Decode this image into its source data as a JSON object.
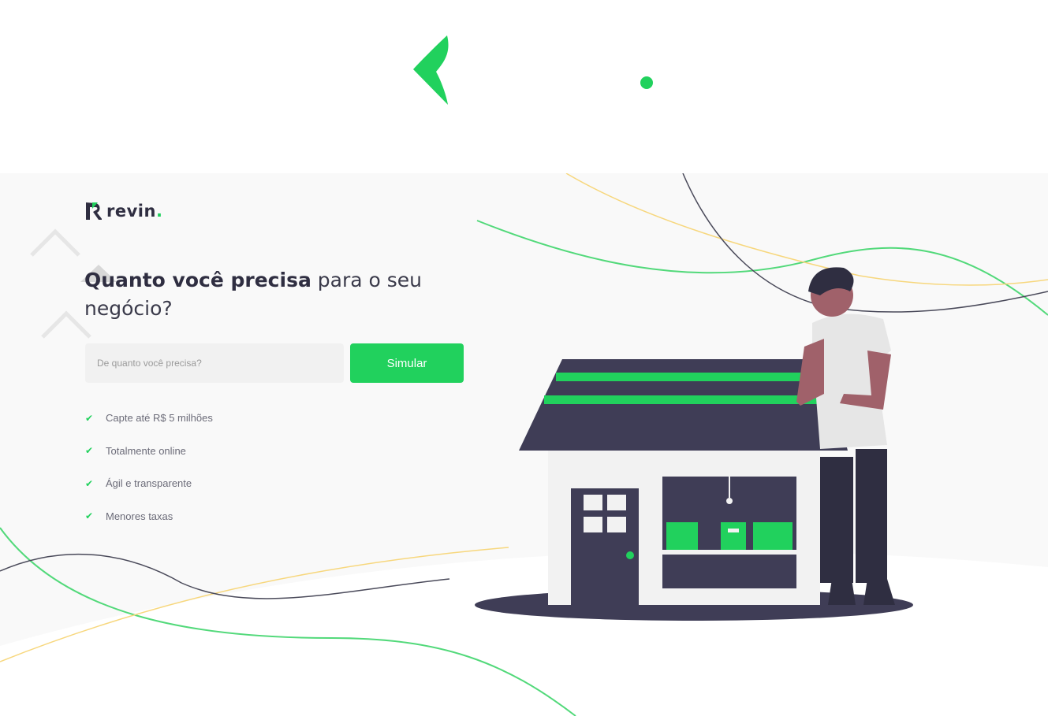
{
  "brand": {
    "name": "revin",
    "dot": ".",
    "green": "#21d15d",
    "dark": "#2f2e41"
  },
  "hero": {
    "headline_bold": "Quanto você precisa",
    "headline_rest": " para o seu negócio?",
    "input": {
      "placeholder": "De quanto você precisa?",
      "value": ""
    },
    "cta_label": "Simular",
    "benefits": [
      "Capte até R$ 5 milhões",
      "Totalmente online",
      "Ágil e transparente",
      "Menores taxas"
    ]
  },
  "icons": {
    "top_logo": "revin-logo-mark",
    "check": "check-icon",
    "illustration": "person-with-store-illustration"
  }
}
